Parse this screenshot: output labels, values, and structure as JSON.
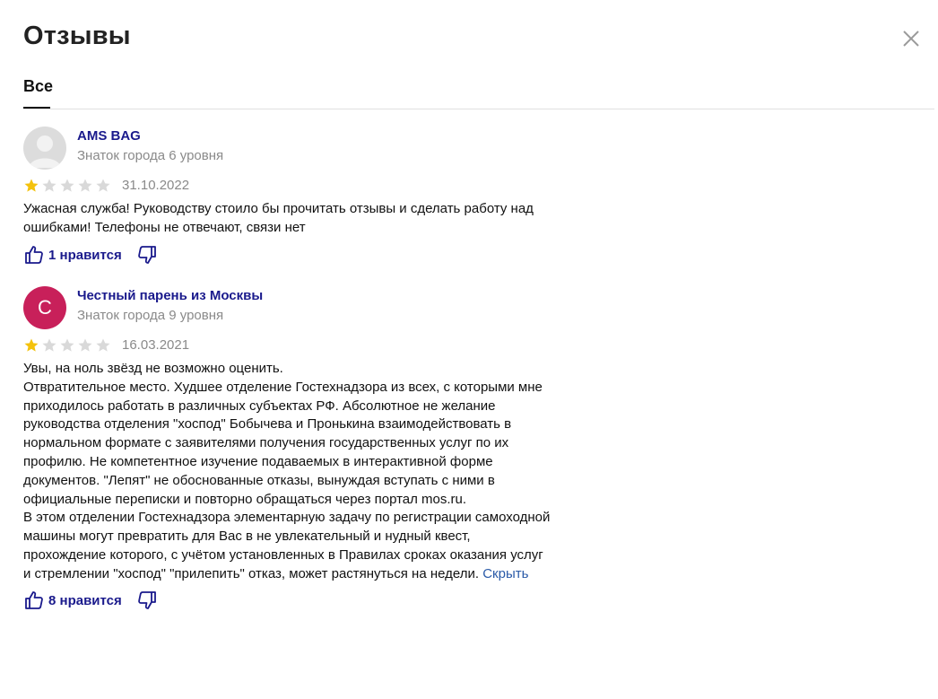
{
  "header": {
    "title": "Отзывы"
  },
  "tabs": [
    {
      "label": "Все",
      "active": true
    }
  ],
  "reviews": [
    {
      "author": "AMS BAG",
      "level": "Знаток города 6 уровня",
      "avatar_letter": "",
      "rating": 1,
      "date": "31.10.2022",
      "text": [
        "Ужасная служба! Руководству стоило бы прочитать отзывы и сделать работу над",
        "ошибками! Телефоны не отвечают, связи нет"
      ],
      "likes": "1 нравится"
    },
    {
      "author": "Честный парень из Москвы",
      "level": "Знаток города 9 уровня",
      "avatar_letter": "С",
      "rating": 1,
      "date": "16.03.2021",
      "text": [
        "Увы, на ноль звёзд не возможно оценить.",
        "Отвратительное место. Худшее отделение Гостехнадзора из всех, с которыми мне",
        "приходилось работать в различных субъектах РФ. Абсолютное не желание",
        "руководства отделения \"хоспод\" Бобычева и Пронькина взаимодействовать в",
        "нормальном формате с заявителями получения государственных услуг по их",
        "профилю. Не компетентное изучение подаваемых в интерактивной форме",
        "документов. \"Лепят\" не обоснованные отказы, вынуждая вступать с ними в",
        "официальные переписки и повторно обращаться через портал mos.ru.",
        "В этом отделении Гостехнадзора элементарную задачу по регистрации самоходной",
        "машины могут превратить для Вас в не увлекательный и нудный квест,",
        "прохождение которого, с учётом установленных в Правилах сроках оказания услуг",
        "и стремлении \"хоспод\" \"прилепить\" отказ, может растянуться на недели."
      ],
      "hide_label": "Скрыть",
      "likes": "8 нравится"
    }
  ],
  "colors": {
    "author": "#1a1a8c",
    "star_filled": "#f4c20d",
    "star_empty": "#d9d9d9",
    "avatar_c": "#c8205a"
  }
}
